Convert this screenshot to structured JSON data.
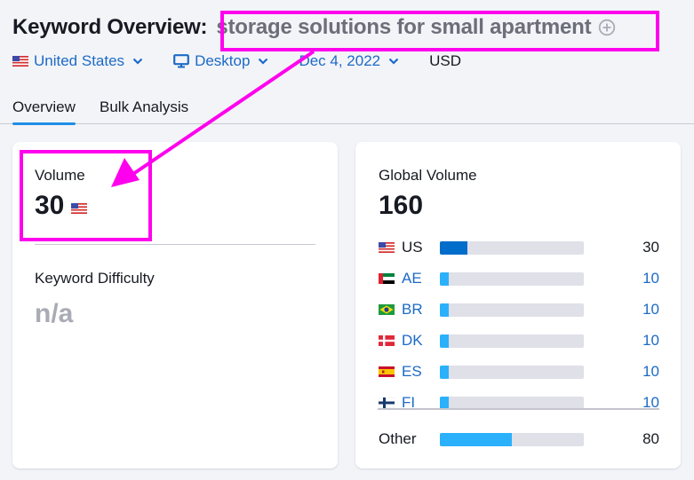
{
  "header": {
    "title_prefix": "Keyword Overview:",
    "keyword": "storage solutions for small apartment",
    "add_icon": "plus-circle-icon"
  },
  "filters": {
    "country": "United States",
    "device": "Desktop",
    "date": "Dec 4, 2022",
    "currency": "USD"
  },
  "tabs": [
    {
      "label": "Overview",
      "active": true
    },
    {
      "label": "Bulk Analysis",
      "active": false
    }
  ],
  "volume_card": {
    "volume_label": "Volume",
    "volume_value": "30",
    "kd_label": "Keyword Difficulty",
    "kd_value": "n/a"
  },
  "global_volume": {
    "label": "Global Volume",
    "total": "160",
    "rows": [
      {
        "code": "US",
        "value": "30",
        "share": 0.19,
        "flag": "us-flag-icon"
      },
      {
        "code": "AE",
        "value": "10",
        "share": 0.06,
        "flag": "ae-flag-icon"
      },
      {
        "code": "BR",
        "value": "10",
        "share": 0.06,
        "flag": "br-flag-icon"
      },
      {
        "code": "DK",
        "value": "10",
        "share": 0.06,
        "flag": "dk-flag-icon"
      },
      {
        "code": "ES",
        "value": "10",
        "share": 0.06,
        "flag": "es-flag-icon"
      },
      {
        "code": "FI",
        "value": "10",
        "share": 0.06,
        "flag": "fi-flag-icon"
      }
    ],
    "other": {
      "label": "Other",
      "value": "80",
      "share": 0.5
    }
  },
  "colors": {
    "annotation": "#ff00ee",
    "link": "#1c6ac6",
    "bar_us": "#006dca",
    "bar_other": "#2bb0fb",
    "bar_track": "#dfe0e8"
  }
}
